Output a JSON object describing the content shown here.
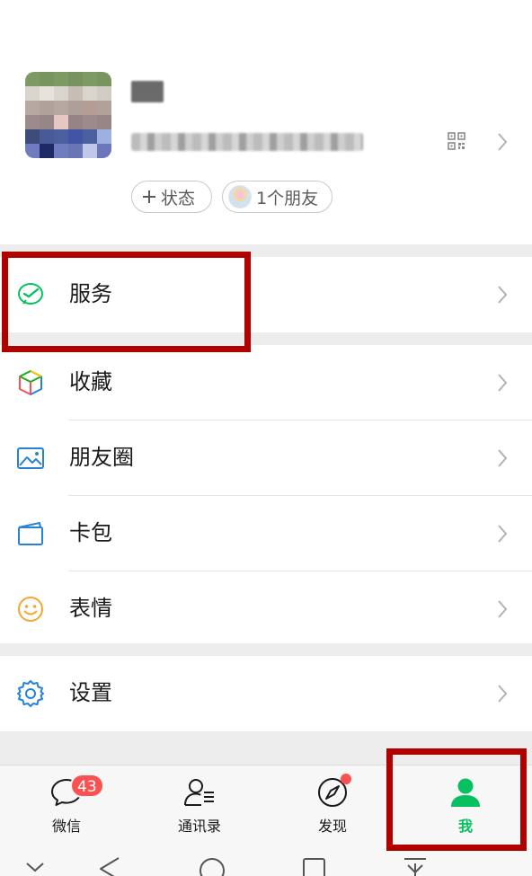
{
  "profile": {
    "status_label": "状态",
    "friends_label": "1个朋友"
  },
  "menu": {
    "services": "服务",
    "favorites": "收藏",
    "moments": "朋友圈",
    "cards": "卡包",
    "stickers": "表情",
    "settings": "设置"
  },
  "tabs": {
    "chats": "微信",
    "chats_badge": "43",
    "contacts": "通讯录",
    "discover": "发现",
    "me": "我"
  },
  "colors": {
    "accent_green": "#07c160",
    "badge_red": "#fa5151",
    "highlight": "#b00000"
  }
}
